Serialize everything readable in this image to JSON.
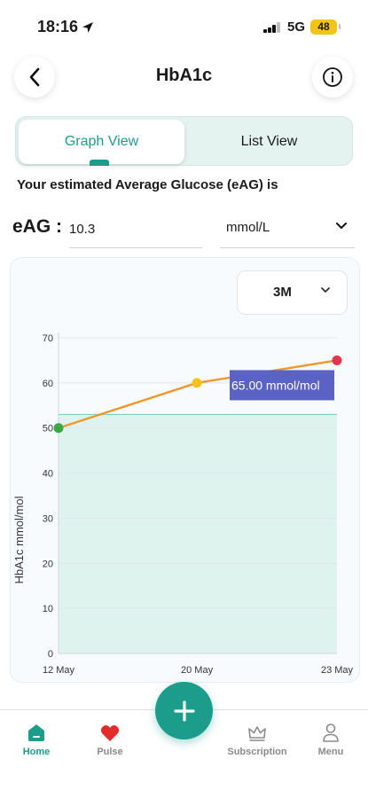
{
  "status_bar": {
    "time": "18:16",
    "network": "5G",
    "battery": "48"
  },
  "header": {
    "title": "HbA1c",
    "back_icon": "chevron-left-icon",
    "info_icon": "info-circle-icon"
  },
  "view_toggle": {
    "tabs": [
      {
        "label": "Graph View",
        "active": true
      },
      {
        "label": "List View",
        "active": false
      }
    ]
  },
  "eag": {
    "caption": "Your estimated Average Glucose (eAG) is",
    "label": "eAG :",
    "value": "10.3",
    "unit": "mmol/L"
  },
  "range": {
    "selected": "3M"
  },
  "chart_data": {
    "type": "line",
    "ylabel": "HbA1c mmol/mol",
    "ylim": [
      0,
      70
    ],
    "y_ticks": [
      "0",
      "10",
      "20",
      "30",
      "40",
      "50",
      "60",
      "70"
    ],
    "x_ticks": [
      "12 May",
      "20 May",
      "23 May"
    ],
    "x": [
      "12 May",
      "20 May",
      "23 May"
    ],
    "series": [
      {
        "values": [
          50,
          60,
          65
        ]
      }
    ],
    "point_colors": [
      "#3aa845",
      "#f5c21a",
      "#e0364a"
    ],
    "line_color": "#f0962a",
    "target_band": {
      "min": 0,
      "max": 53,
      "color": "#dff3ee",
      "line_color": "#7fd1c1"
    },
    "tooltip": "65.00 mmol/mol",
    "grid": true
  },
  "fab": {
    "icon": "plus-icon"
  },
  "bottom_nav": {
    "items": [
      {
        "label": "Home",
        "icon": "home-icon",
        "active": true
      },
      {
        "label": "Pulse",
        "icon": "heart-icon",
        "active": false
      },
      {
        "label": "Subscription",
        "icon": "crown-icon",
        "active": false
      },
      {
        "label": "Menu",
        "icon": "user-icon",
        "active": false
      }
    ]
  }
}
